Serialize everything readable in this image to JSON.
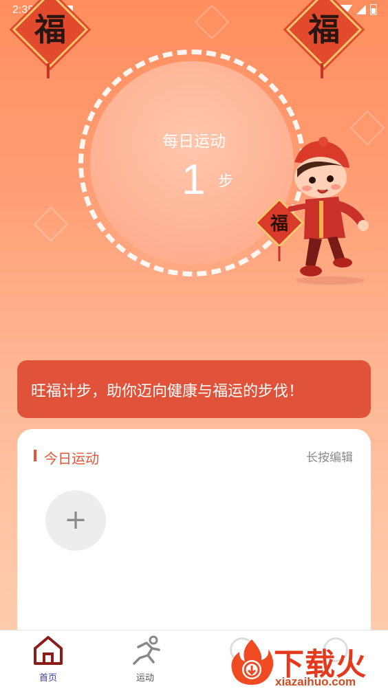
{
  "status_bar": {
    "time": "2:38"
  },
  "decorations": {
    "fu_char": "福"
  },
  "daily": {
    "title": "每日运动",
    "steps": "1",
    "unit": "步"
  },
  "banner": {
    "text": "旺福计步，助你迈向健康与福运的步伐！"
  },
  "today_card": {
    "title": "今日运动",
    "edit_label": "长按编辑",
    "add_symbol": "+"
  },
  "tabbar": {
    "tabs": [
      {
        "label": "首页"
      },
      {
        "label": "运动"
      }
    ]
  },
  "watermark": {
    "title": "下载火",
    "url": "xiazaihuo.com"
  },
  "colors": {
    "accent": "#e0523a",
    "tab_active": "#3b3ba8"
  }
}
